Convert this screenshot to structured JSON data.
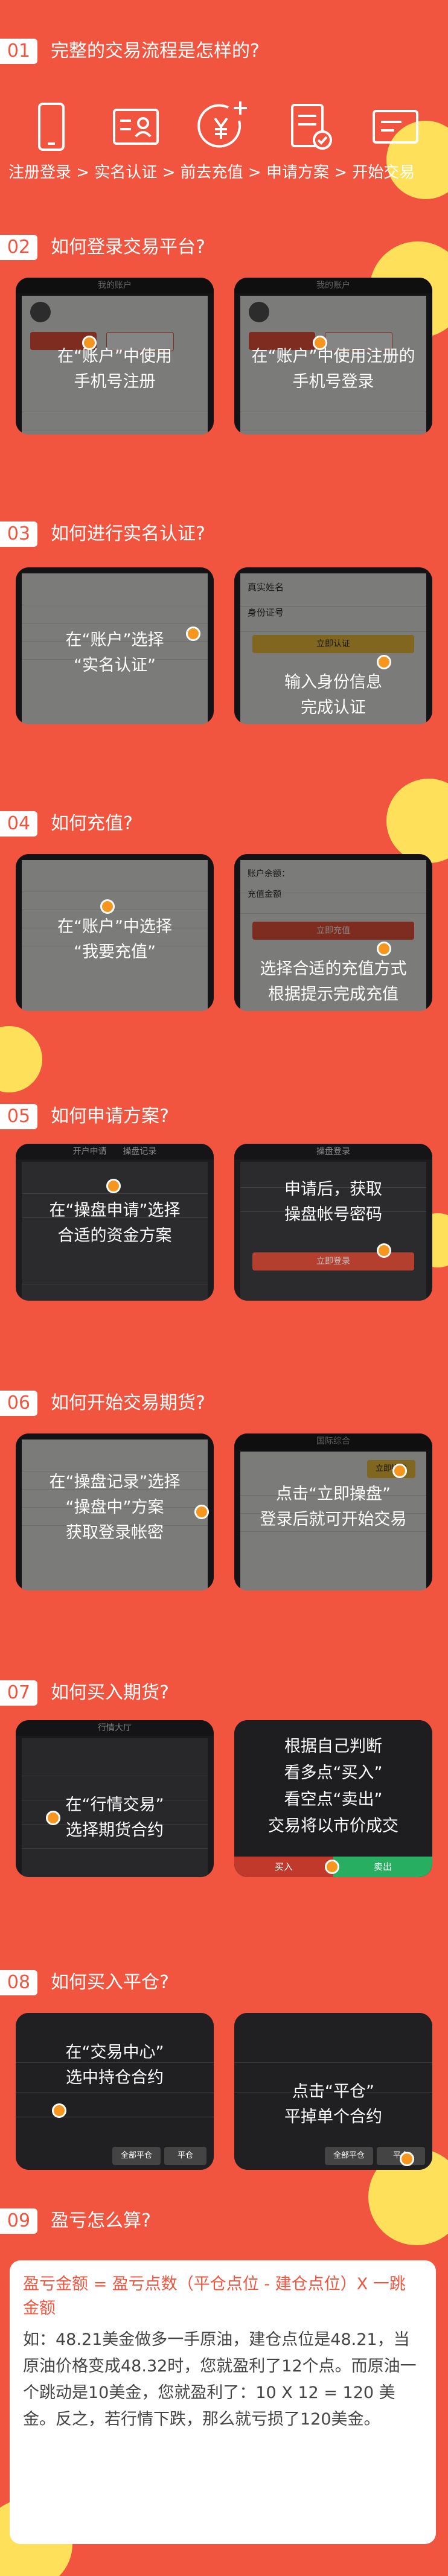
{
  "sections": {
    "s01": {
      "num": "01",
      "title": "完整的交易流程是怎样的?"
    },
    "s02": {
      "num": "02",
      "title": "如何登录交易平台?"
    },
    "s03": {
      "num": "03",
      "title": "如何进行实名认证?"
    },
    "s04": {
      "num": "04",
      "title": "如何充值?"
    },
    "s05": {
      "num": "05",
      "title": "如何申请方案?"
    },
    "s06": {
      "num": "06",
      "title": "如何开始交易期货?"
    },
    "s07": {
      "num": "07",
      "title": "如何买入期货?"
    },
    "s08": {
      "num": "08",
      "title": "如何买入平仓?"
    },
    "s09": {
      "num": "09",
      "title": "盈亏怎么算?"
    }
  },
  "flow": {
    "steps_text": "注册登录 > 实名认证 > 前去充值 > 申请方案 > 开始交易",
    "icons": [
      "phone-icon",
      "id-card-icon",
      "yuan-plus-icon",
      "document-check-icon",
      "card-icon"
    ]
  },
  "cards": {
    "c02a": {
      "caption": "在“账户”中使用\n手机号注册",
      "topbar": "我的账户"
    },
    "c02b": {
      "caption": "在“账户”中使用注册的\n手机号登录",
      "topbar": "我的账户"
    },
    "c03a": {
      "caption": "在“账户”选择\n“实名认证”"
    },
    "c03b": {
      "caption": "输入身份信息\n完成认证",
      "field1": "真实姓名",
      "field2": "身份证号",
      "button": "立即认证"
    },
    "c04a": {
      "caption": "在“账户”中选择\n“我要充值”"
    },
    "c04b": {
      "caption": "选择合适的充值方式\n根据提示完成充值",
      "field1": "账户余额：",
      "field2": "充值金额",
      "button": "立即充值"
    },
    "c05a": {
      "caption": "在“操盘申请”选择\n合适的资金方案",
      "tab1": "开户申请",
      "tab2": "操盘记录"
    },
    "c05b": {
      "caption": "申请后，获取\n操盘帐号密码",
      "topbar": "操盘登录",
      "button": "立即登录"
    },
    "c06a": {
      "caption": "在“操盘记录”选择\n“操盘中”方案\n获取登录帐密"
    },
    "c06b": {
      "caption": "点击“立即操盘”\n登录后就可开始交易",
      "topbar": "国际综合",
      "button": "立即操盘"
    },
    "c07a": {
      "caption": "在“行情交易”\n选择期货合约",
      "topbar": "行情大厅"
    },
    "c07b": {
      "caption": "根据自己判断\n看多点“买入”\n看空点“卖出”\n交易将以市价成交",
      "btn_buy": "买入",
      "btn_sell": "卖出"
    },
    "c08a": {
      "caption": "在“交易中心”\n选中持仓合约",
      "btn1": "全部平仓",
      "btn2": "平仓"
    },
    "c08b": {
      "caption": "点击“平仓”\n平掉单个合约",
      "btn1": "全部平仓",
      "btn2": "平仓"
    }
  },
  "formula": {
    "title": "盈亏金额 = 盈亏点数（平仓点位 - 建仓点位）X 一跳金额",
    "body": "如：48.21美金做多一手原油，建仓点位是48.21，当原油价格变成48.32时，您就盈利了12个点。而原油一个跳动是10美金，您就盈利了：10 X 12 = 120 美金。反之，若行情下跌，那么就亏损了120美金。"
  },
  "colors": {
    "background": "#f2553f",
    "accent": "#f6961e",
    "deco": "#ffe05a"
  }
}
